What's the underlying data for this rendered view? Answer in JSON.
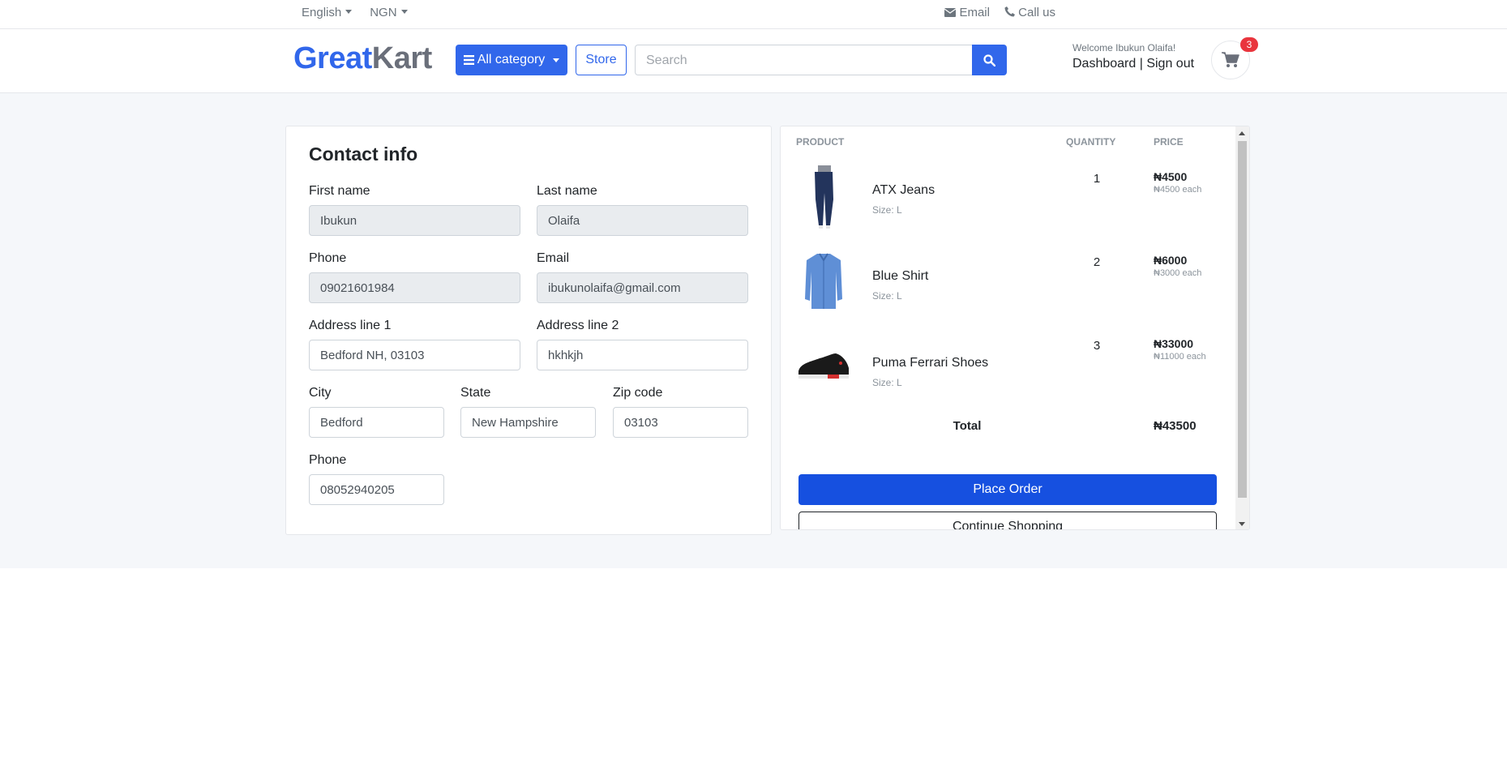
{
  "topbar": {
    "language": "English",
    "currency": "NGN",
    "email_label": "Email",
    "call_label": "Call us"
  },
  "header": {
    "logo_great": "Great",
    "logo_kart": "Kart",
    "category_label": "All category",
    "store_label": "Store",
    "search_placeholder": "Search",
    "welcome": "Welcome Ibukun Olaifa!",
    "dashboard_link": "Dashboard",
    "separator": " | ",
    "signout_link": "Sign out",
    "cart_count": "3"
  },
  "contact": {
    "title": "Contact info",
    "first_name": {
      "label": "First name",
      "value": "Ibukun"
    },
    "last_name": {
      "label": "Last name",
      "value": "Olaifa"
    },
    "phone": {
      "label": "Phone",
      "value": "09021601984"
    },
    "email": {
      "label": "Email",
      "value": "ibukunolaifa@gmail.com"
    },
    "address1": {
      "label": "Address line 1",
      "value": "Bedford NH, 03103"
    },
    "address2": {
      "label": "Address line 2",
      "value": "hkhkjh"
    },
    "city": {
      "label": "City",
      "value": "Bedford"
    },
    "state": {
      "label": "State",
      "value": "New Hampshire"
    },
    "zip": {
      "label": "Zip code",
      "value": "03103"
    },
    "phone2": {
      "label": "Phone",
      "value": "08052940205"
    }
  },
  "order": {
    "headers": {
      "product": "PRODUCT",
      "quantity": "QUANTITY",
      "price": "PRICE"
    },
    "items": [
      {
        "name": "ATX Jeans",
        "size": "Size: L",
        "qty": "1",
        "price": "₦4500",
        "each": "₦4500 each",
        "image": "jeans-image"
      },
      {
        "name": "Blue Shirt",
        "size": "Size: L",
        "qty": "2",
        "price": "₦6000",
        "each": "₦3000 each",
        "image": "shirt-image"
      },
      {
        "name": "Puma Ferrari Shoes",
        "size": "Size: L",
        "qty": "3",
        "price": "₦33000",
        "each": "₦11000 each",
        "image": "shoes-image"
      }
    ],
    "total_label": "Total",
    "total_value": "₦43500",
    "place_order": "Place Order",
    "continue_shopping": "Continue Shopping"
  },
  "colors": {
    "brand": "#3167eb",
    "place_order": "#1650e0",
    "badge": "#e9353d"
  }
}
